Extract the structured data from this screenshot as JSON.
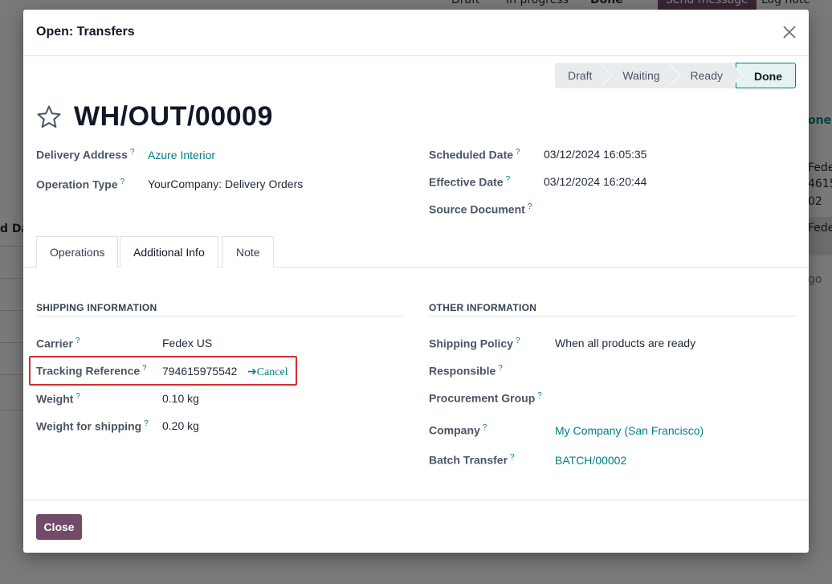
{
  "background": {
    "statuses": [
      "Draft",
      "In progress",
      "Done"
    ],
    "buttons": [
      "Send message",
      "Log note"
    ],
    "left_header": "d Dat",
    "right_snippets": [
      "one",
      "Fede",
      "4615",
      "02",
      "Fede",
      "go"
    ]
  },
  "modal": {
    "title": "Open: Transfers",
    "statusbar": [
      "Draft",
      "Waiting",
      "Ready",
      "Done"
    ],
    "active_status": "Done",
    "record_title": "WH/OUT/00009",
    "help_marker": "?",
    "left_fields": [
      {
        "label": "Delivery Address",
        "value": "Azure Interior",
        "link": true
      },
      {
        "label": "Operation Type",
        "value": "YourCompany: Delivery Orders",
        "link": false
      }
    ],
    "right_fields": [
      {
        "label": "Scheduled Date",
        "value": "03/12/2024 16:05:35"
      },
      {
        "label": "Effective Date",
        "value": "03/12/2024 16:20:44"
      },
      {
        "label": "Source Document",
        "value": ""
      }
    ],
    "tabs": [
      "Operations",
      "Additional Info",
      "Note"
    ],
    "active_tab": "Additional Info",
    "shipping": {
      "title": "SHIPPING INFORMATION",
      "fields": [
        {
          "label": "Carrier",
          "value": "Fedex US"
        },
        {
          "label": "Tracking Reference",
          "value": "794615975542"
        },
        {
          "label": "Weight",
          "value": "0.10 kg"
        },
        {
          "label": "Weight for shipping",
          "value": "0.20 kg"
        }
      ],
      "cancel_label": "➔Cancel"
    },
    "other": {
      "title": "OTHER INFORMATION",
      "fields": [
        {
          "label": "Shipping Policy",
          "value": "When all products are ready",
          "link": false
        },
        {
          "label": "Responsible",
          "value": "",
          "link": false
        },
        {
          "label": "Procurement Group",
          "value": "",
          "link": false
        },
        {
          "label": "Company",
          "value": "My Company (San Francisco)",
          "link": true
        },
        {
          "label": "Batch Transfer",
          "value": "BATCH/00002",
          "link": true
        }
      ]
    },
    "close_button": "Close"
  },
  "colors": {
    "accent": "#017e84",
    "primary_button": "#714b67",
    "highlight_border": "#d32f2f"
  }
}
